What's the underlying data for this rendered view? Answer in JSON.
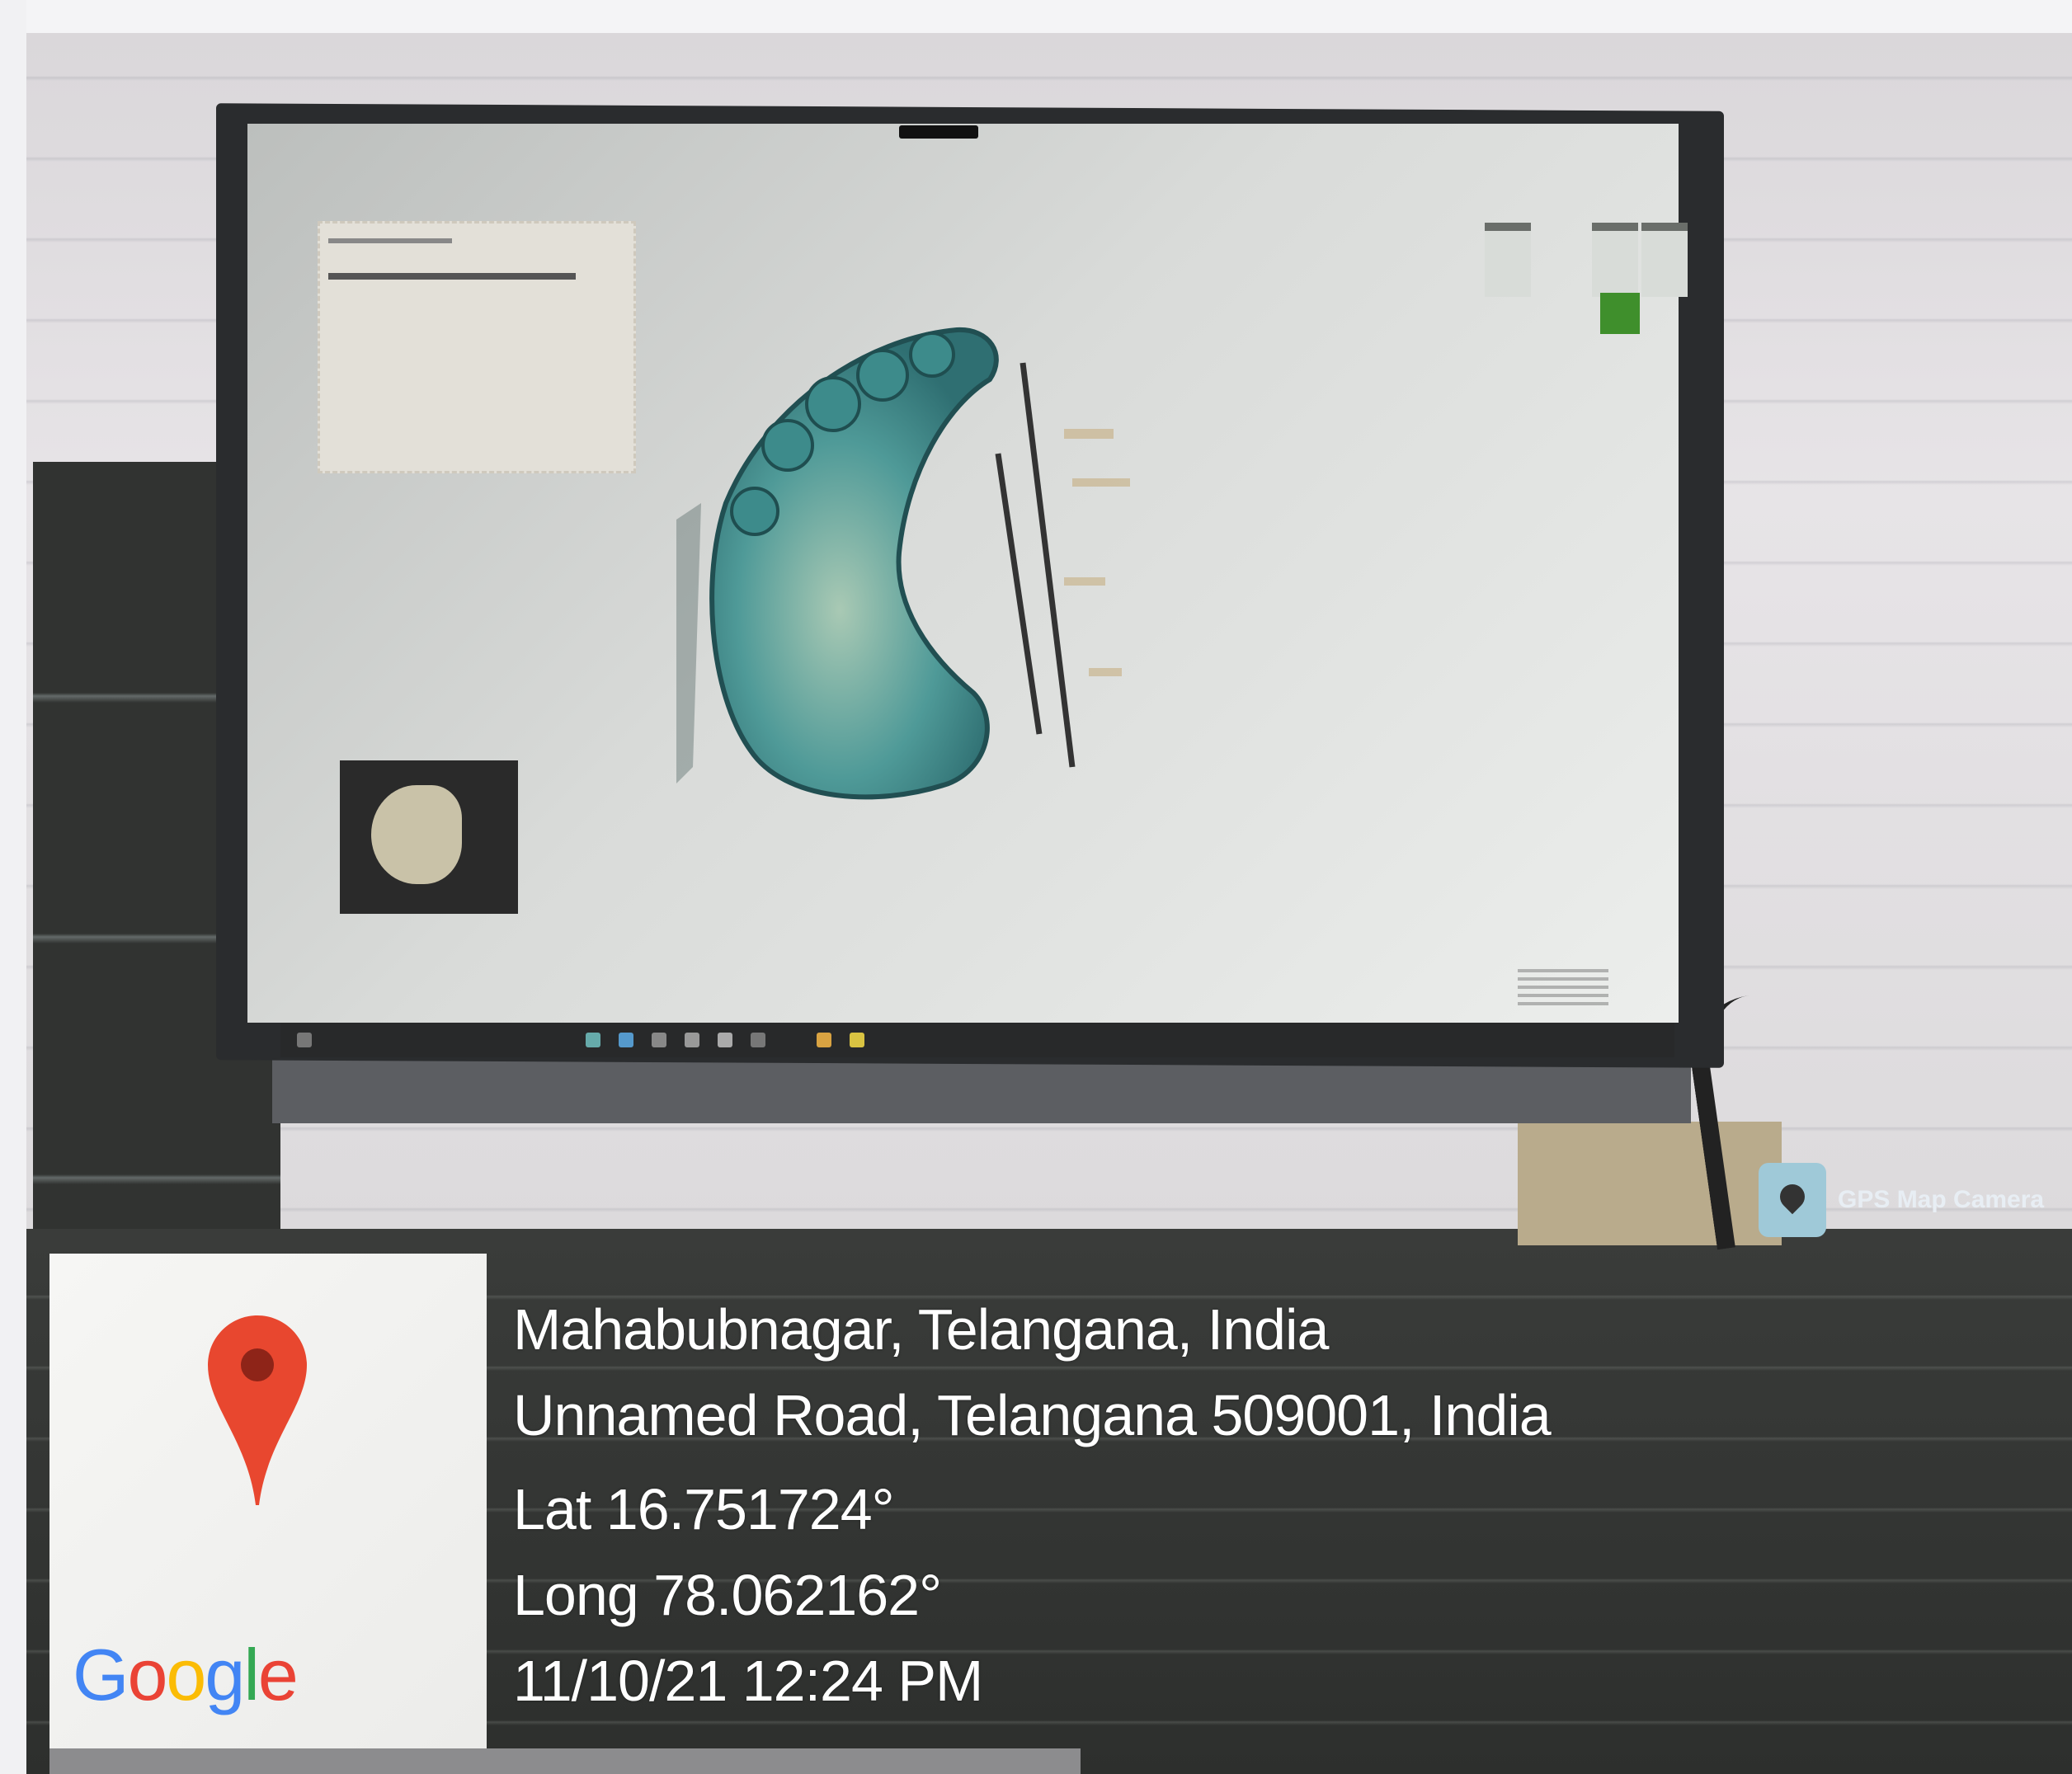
{
  "overlay": {
    "place_title": "Mahabubnagar, Telangana, India",
    "address": "Unnamed Road, Telangana 509001, India",
    "latitude": "Lat 16.751724°",
    "longitude": "Long 78.062162°",
    "datetime": "11/10/21 12:24 PM"
  },
  "badge": {
    "label": "GPS Map Camera",
    "icon": "map-pin-icon"
  },
  "map_tile": {
    "logo_letters": [
      "G",
      "o",
      "o",
      "g",
      "l",
      "e"
    ],
    "logo_colors": [
      "#4285F4",
      "#EA4335",
      "#FBBC05",
      "#4285F4",
      "#34A853",
      "#EA4335"
    ],
    "pin_color": "#e8472f",
    "pin_icon": "location-pin-icon"
  },
  "scene": {
    "monitor_screen_color": "#e6e8e6",
    "model_color": "#4fa3a0"
  }
}
